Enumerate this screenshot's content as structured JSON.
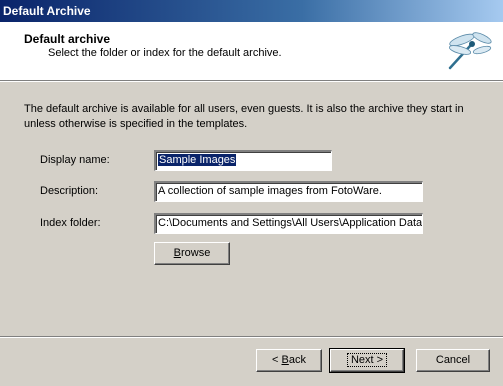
{
  "window": {
    "title": "Default Archive"
  },
  "header": {
    "title": "Default archive",
    "subtitle": "Select the folder or index for the default archive."
  },
  "intro": "The default archive is available for all users, even guests. It is also the archive they start in unless otherwise is specified in the templates.",
  "form": {
    "display_name": {
      "label": "Display name:",
      "value": "Sample Images"
    },
    "description": {
      "label": "Description:",
      "value": "A collection of sample images from FotoWare."
    },
    "index_folder": {
      "label": "Index folder:",
      "value": "C:\\Documents and Settings\\All Users\\Application Data"
    },
    "browse": {
      "accel": "B",
      "rest": "rowse"
    }
  },
  "buttons": {
    "back": {
      "prefix": "< ",
      "accel": "B",
      "rest": "ack"
    },
    "next": {
      "label": "Next >"
    },
    "cancel": {
      "label": "Cancel"
    }
  },
  "icons": {
    "logo": "dragonfly-icon"
  }
}
